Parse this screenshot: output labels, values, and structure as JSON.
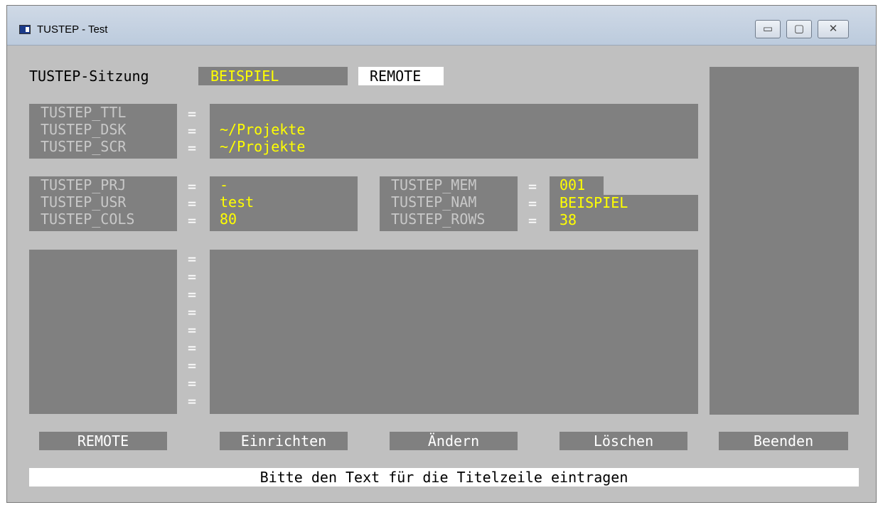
{
  "window": {
    "title": "TUSTEP - Test",
    "controls": {
      "minimize": "▭",
      "maximize": "▢",
      "close": "✕"
    }
  },
  "session": {
    "label": "TUSTEP-Sitzung",
    "name": "BEISPIEL",
    "mode": "REMOTE"
  },
  "env_group1": {
    "labels": [
      "TUSTEP_TTL",
      "TUSTEP_DSK",
      "TUSTEP_SCR"
    ],
    "values": [
      "",
      "~/Projekte",
      "~/Projekte"
    ]
  },
  "env_group2_left": {
    "labels": [
      "TUSTEP_PRJ",
      "TUSTEP_USR",
      "TUSTEP_COLS"
    ],
    "values": [
      "-",
      "test",
      "80"
    ]
  },
  "env_group2_right": {
    "labels": [
      "TUSTEP_MEM",
      "TUSTEP_NAM",
      "TUSTEP_ROWS"
    ],
    "values": [
      "001",
      "BEISPIEL",
      "38"
    ]
  },
  "equals_sign": "=",
  "buttons": {
    "remote": "REMOTE",
    "setup": "Einrichten",
    "change": "Ändern",
    "delete": "Löschen",
    "quit": "Beenden"
  },
  "status": "Bitte den Text für die Titelzeile eintragen",
  "colors": {
    "value_text": "#ffff00",
    "label_text": "#c8c8c8",
    "field_bg": "#808080",
    "client_bg": "#c0c0c0"
  }
}
